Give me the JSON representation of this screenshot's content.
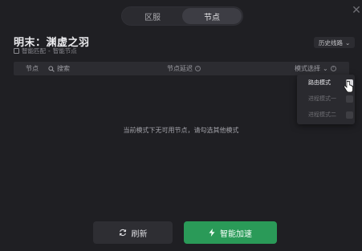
{
  "tabs": [
    {
      "label": "区服",
      "active": false
    },
    {
      "label": "节点",
      "active": true
    }
  ],
  "close_icon": "close-icon",
  "title": "明末：渊虚之羽",
  "subtitle": {
    "mode": "智能匹配",
    "separator": "-",
    "node": "智能节点"
  },
  "history_button": "历史线路",
  "table_header": {
    "node": "节点",
    "search_placeholder": "搜索",
    "delay": "节点延迟",
    "mode": "模式选择"
  },
  "empty_message": "当前模式下无可用节点，请勾选其他模式",
  "mode_dropdown": [
    {
      "label": "路由模式",
      "checked": true
    },
    {
      "label": "进程模式一",
      "checked": false
    },
    {
      "label": "进程模式二",
      "checked": false
    }
  ],
  "buttons": {
    "refresh": "刷新",
    "accelerate": "智能加速"
  },
  "colors": {
    "accent": "#2a9a58",
    "background": "#1f1f23"
  }
}
